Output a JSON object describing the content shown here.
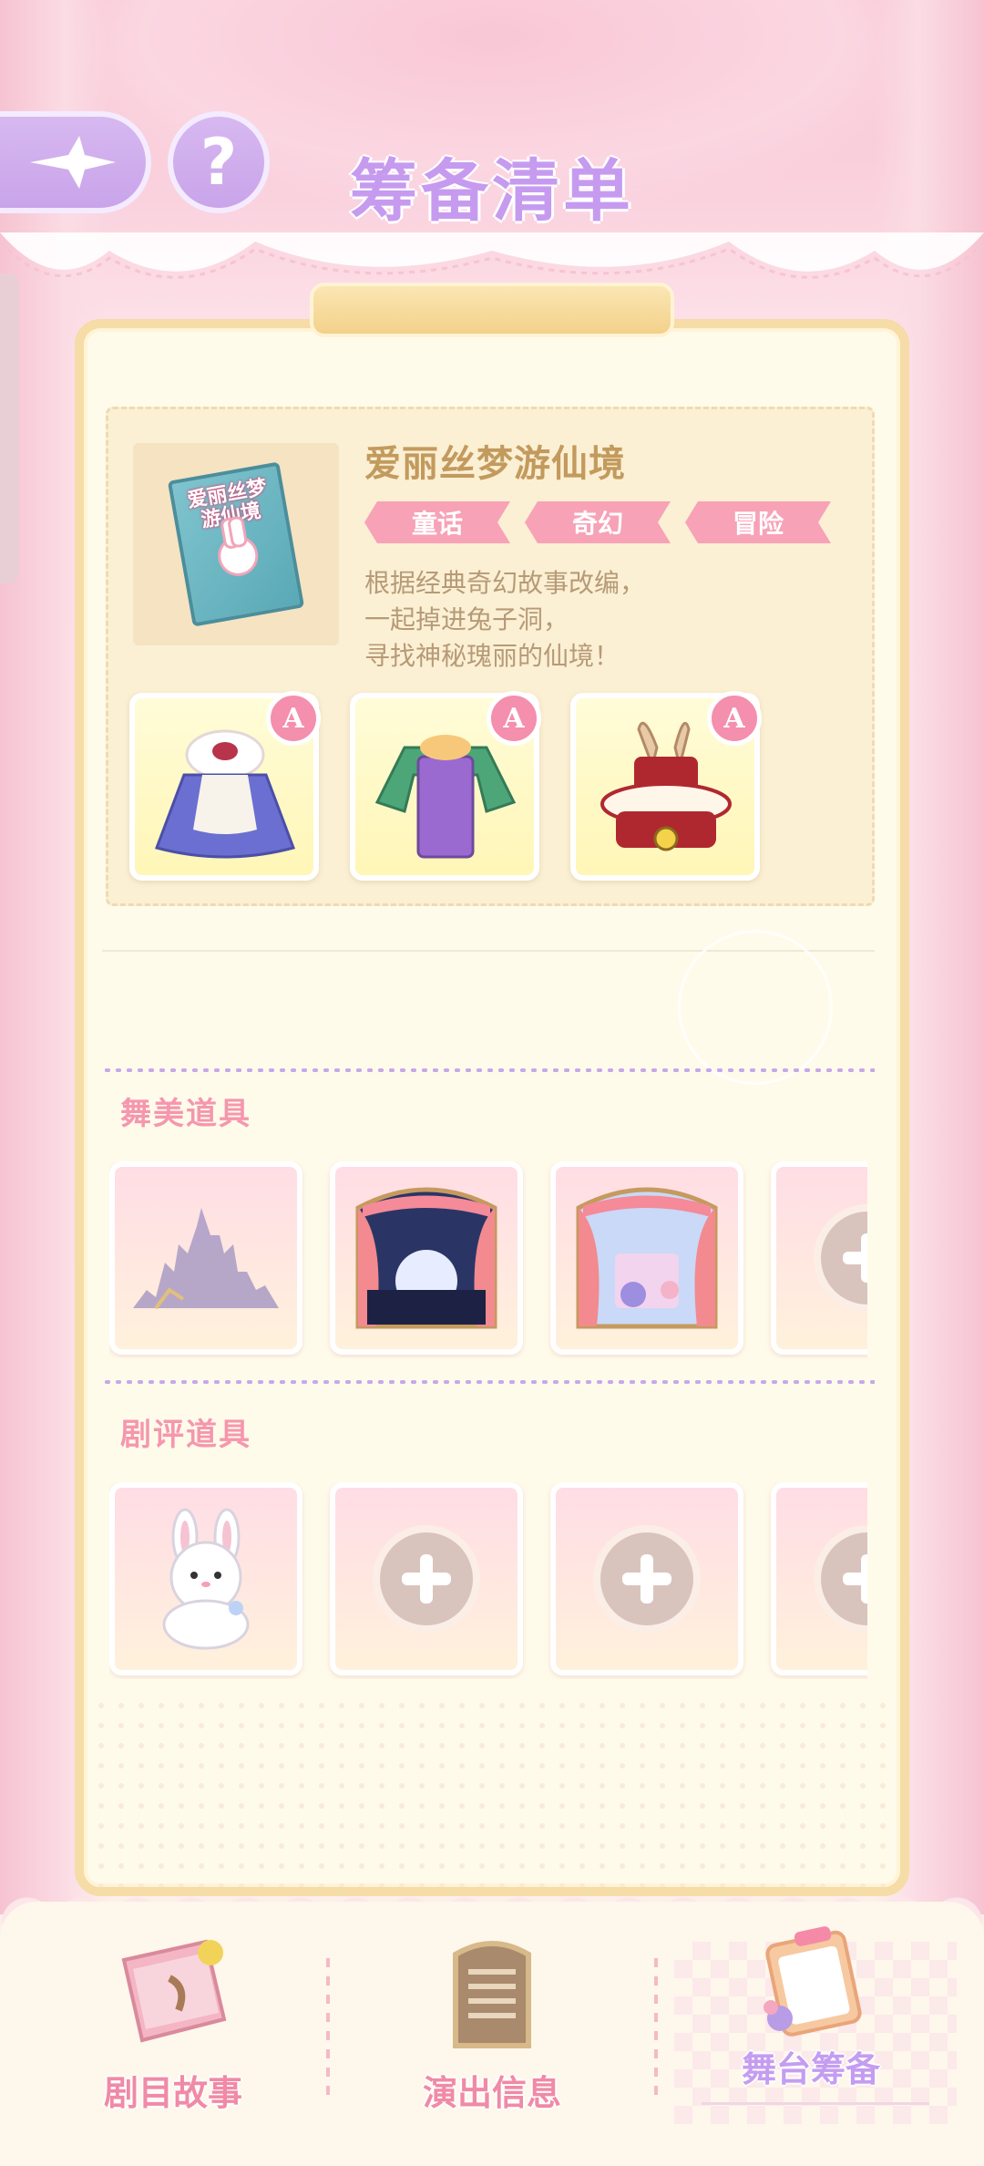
{
  "header": {
    "title": "筹备清单",
    "help_label": "?"
  },
  "script": {
    "cover_title": "爱丽丝梦游仙境",
    "title": "爱丽丝梦游仙境",
    "tags": [
      "童话",
      "奇幻",
      "冒险"
    ],
    "description": [
      "根据经典奇幻故事改编，",
      "一起掉进兔子洞，",
      "寻找神秘瑰丽的仙境！"
    ],
    "costumes": [
      {
        "grade": "A",
        "icon": "blue-dress-icon"
      },
      {
        "grade": "A",
        "icon": "green-suit-icon"
      },
      {
        "grade": "A",
        "icon": "rabbit-hat-icon"
      }
    ]
  },
  "stage_props": {
    "title": "舞美道具",
    "slots": [
      {
        "icon": "castle-silhouette-icon"
      },
      {
        "icon": "night-moon-stage-icon"
      },
      {
        "icon": "wonderland-stage-icon"
      },
      {
        "icon": "add-icon"
      }
    ]
  },
  "review_props": {
    "title": "剧评道具",
    "slots": [
      {
        "icon": "bunny-plush-icon"
      },
      {
        "icon": "add-icon"
      },
      {
        "icon": "add-icon"
      },
      {
        "icon": "add-icon"
      }
    ]
  },
  "nav": {
    "items": [
      {
        "label": "剧目故事",
        "icon": "storybook-icon"
      },
      {
        "label": "演出信息",
        "icon": "info-board-icon"
      },
      {
        "label": "舞台筹备",
        "icon": "clipboard-icon",
        "active": true
      }
    ]
  },
  "colors": {
    "accent_purple": "#c69bef",
    "accent_pink": "#f597ae",
    "panel_bg": "#fffbeb",
    "panel_border": "#f6dca6"
  }
}
